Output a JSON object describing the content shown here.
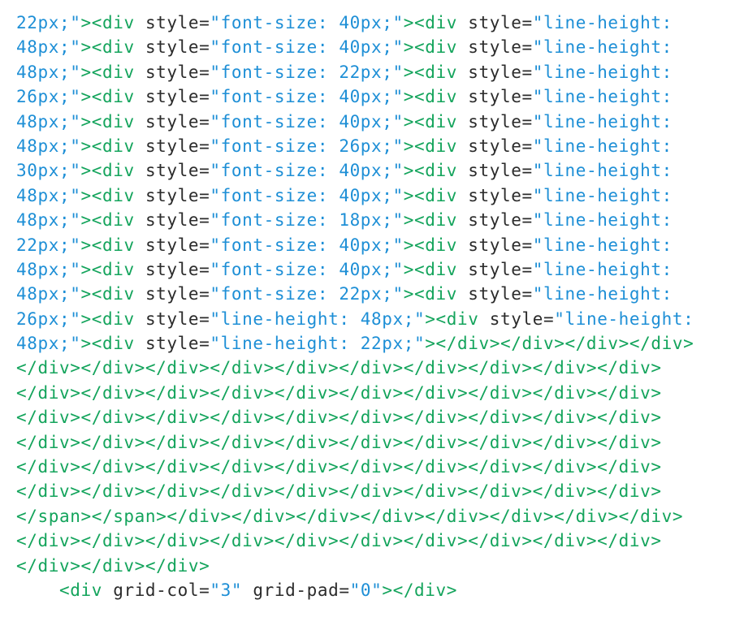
{
  "colors": {
    "value": "#1e8fd6",
    "tag": "#14a45c",
    "attr": "#2b2b2b",
    "background": "#ffffff"
  },
  "lines": [
    [
      [
        "value",
        "22px;\""
      ],
      [
        "tag",
        "><div "
      ],
      [
        "attr",
        "style="
      ],
      [
        "value",
        "\"font-size: 40px;\""
      ],
      [
        "tag",
        "><div "
      ],
      [
        "attr",
        "style="
      ],
      [
        "value",
        "\"line-height:"
      ]
    ],
    [
      [
        "value",
        "48px;\""
      ],
      [
        "tag",
        "><div "
      ],
      [
        "attr",
        "style="
      ],
      [
        "value",
        "\"font-size: 40px;\""
      ],
      [
        "tag",
        "><div "
      ],
      [
        "attr",
        "style="
      ],
      [
        "value",
        "\"line-height:"
      ]
    ],
    [
      [
        "value",
        "48px;\""
      ],
      [
        "tag",
        "><div "
      ],
      [
        "attr",
        "style="
      ],
      [
        "value",
        "\"font-size: 22px;\""
      ],
      [
        "tag",
        "><div "
      ],
      [
        "attr",
        "style="
      ],
      [
        "value",
        "\"line-height:"
      ]
    ],
    [
      [
        "value",
        "26px;\""
      ],
      [
        "tag",
        "><div "
      ],
      [
        "attr",
        "style="
      ],
      [
        "value",
        "\"font-size: 40px;\""
      ],
      [
        "tag",
        "><div "
      ],
      [
        "attr",
        "style="
      ],
      [
        "value",
        "\"line-height:"
      ]
    ],
    [
      [
        "value",
        "48px;\""
      ],
      [
        "tag",
        "><div "
      ],
      [
        "attr",
        "style="
      ],
      [
        "value",
        "\"font-size: 40px;\""
      ],
      [
        "tag",
        "><div "
      ],
      [
        "attr",
        "style="
      ],
      [
        "value",
        "\"line-height:"
      ]
    ],
    [
      [
        "value",
        "48px;\""
      ],
      [
        "tag",
        "><div "
      ],
      [
        "attr",
        "style="
      ],
      [
        "value",
        "\"font-size: 26px;\""
      ],
      [
        "tag",
        "><div "
      ],
      [
        "attr",
        "style="
      ],
      [
        "value",
        "\"line-height:"
      ]
    ],
    [
      [
        "value",
        "30px;\""
      ],
      [
        "tag",
        "><div "
      ],
      [
        "attr",
        "style="
      ],
      [
        "value",
        "\"font-size: 40px;\""
      ],
      [
        "tag",
        "><div "
      ],
      [
        "attr",
        "style="
      ],
      [
        "value",
        "\"line-height:"
      ]
    ],
    [
      [
        "value",
        "48px;\""
      ],
      [
        "tag",
        "><div "
      ],
      [
        "attr",
        "style="
      ],
      [
        "value",
        "\"font-size: 40px;\""
      ],
      [
        "tag",
        "><div "
      ],
      [
        "attr",
        "style="
      ],
      [
        "value",
        "\"line-height:"
      ]
    ],
    [
      [
        "value",
        "48px;\""
      ],
      [
        "tag",
        "><div "
      ],
      [
        "attr",
        "style="
      ],
      [
        "value",
        "\"font-size: 18px;\""
      ],
      [
        "tag",
        "><div "
      ],
      [
        "attr",
        "style="
      ],
      [
        "value",
        "\"line-height:"
      ]
    ],
    [
      [
        "value",
        "22px;\""
      ],
      [
        "tag",
        "><div "
      ],
      [
        "attr",
        "style="
      ],
      [
        "value",
        "\"font-size: 40px;\""
      ],
      [
        "tag",
        "><div "
      ],
      [
        "attr",
        "style="
      ],
      [
        "value",
        "\"line-height:"
      ]
    ],
    [
      [
        "value",
        "48px;\""
      ],
      [
        "tag",
        "><div "
      ],
      [
        "attr",
        "style="
      ],
      [
        "value",
        "\"font-size: 40px;\""
      ],
      [
        "tag",
        "><div "
      ],
      [
        "attr",
        "style="
      ],
      [
        "value",
        "\"line-height:"
      ]
    ],
    [
      [
        "value",
        "48px;\""
      ],
      [
        "tag",
        "><div "
      ],
      [
        "attr",
        "style="
      ],
      [
        "value",
        "\"font-size: 22px;\""
      ],
      [
        "tag",
        "><div "
      ],
      [
        "attr",
        "style="
      ],
      [
        "value",
        "\"line-height:"
      ]
    ],
    [
      [
        "value",
        "26px;\""
      ],
      [
        "tag",
        "><div "
      ],
      [
        "attr",
        "style="
      ],
      [
        "value",
        "\"line-height: 48px;\""
      ],
      [
        "tag",
        "><div "
      ],
      [
        "attr",
        "style="
      ],
      [
        "value",
        "\"line-height:"
      ]
    ],
    [
      [
        "value",
        "48px;\""
      ],
      [
        "tag",
        "><div "
      ],
      [
        "attr",
        "style="
      ],
      [
        "value",
        "\"line-height: 22px;\""
      ],
      [
        "tag",
        "></div></div></div></div>"
      ]
    ],
    [
      [
        "tag",
        "</div></div></div></div></div></div></div></div></div></div>"
      ]
    ],
    [
      [
        "tag",
        "</div></div></div></div></div></div></div></div></div></div>"
      ]
    ],
    [
      [
        "tag",
        "</div></div></div></div></div></div></div></div></div></div>"
      ]
    ],
    [
      [
        "tag",
        "</div></div></div></div></div></div></div></div></div></div>"
      ]
    ],
    [
      [
        "tag",
        "</div></div></div></div></div></div></div></div></div></div>"
      ]
    ],
    [
      [
        "tag",
        "</div></div></div></div></div></div></div></div></div></div>"
      ]
    ],
    [
      [
        "tag",
        "</span></span></div></div></div></div></div></div></div></div>"
      ]
    ],
    [
      [
        "tag",
        "</div></div></div></div></div></div></div></div></div></div>"
      ]
    ],
    [
      [
        "tag",
        "</div></div></div>"
      ]
    ],
    [
      [
        "tag",
        "    <div "
      ],
      [
        "attr",
        "grid-col="
      ],
      [
        "value",
        "\"3\" "
      ],
      [
        "attr",
        "grid-pad="
      ],
      [
        "value",
        "\"0\""
      ],
      [
        "tag",
        "></div>"
      ]
    ]
  ]
}
